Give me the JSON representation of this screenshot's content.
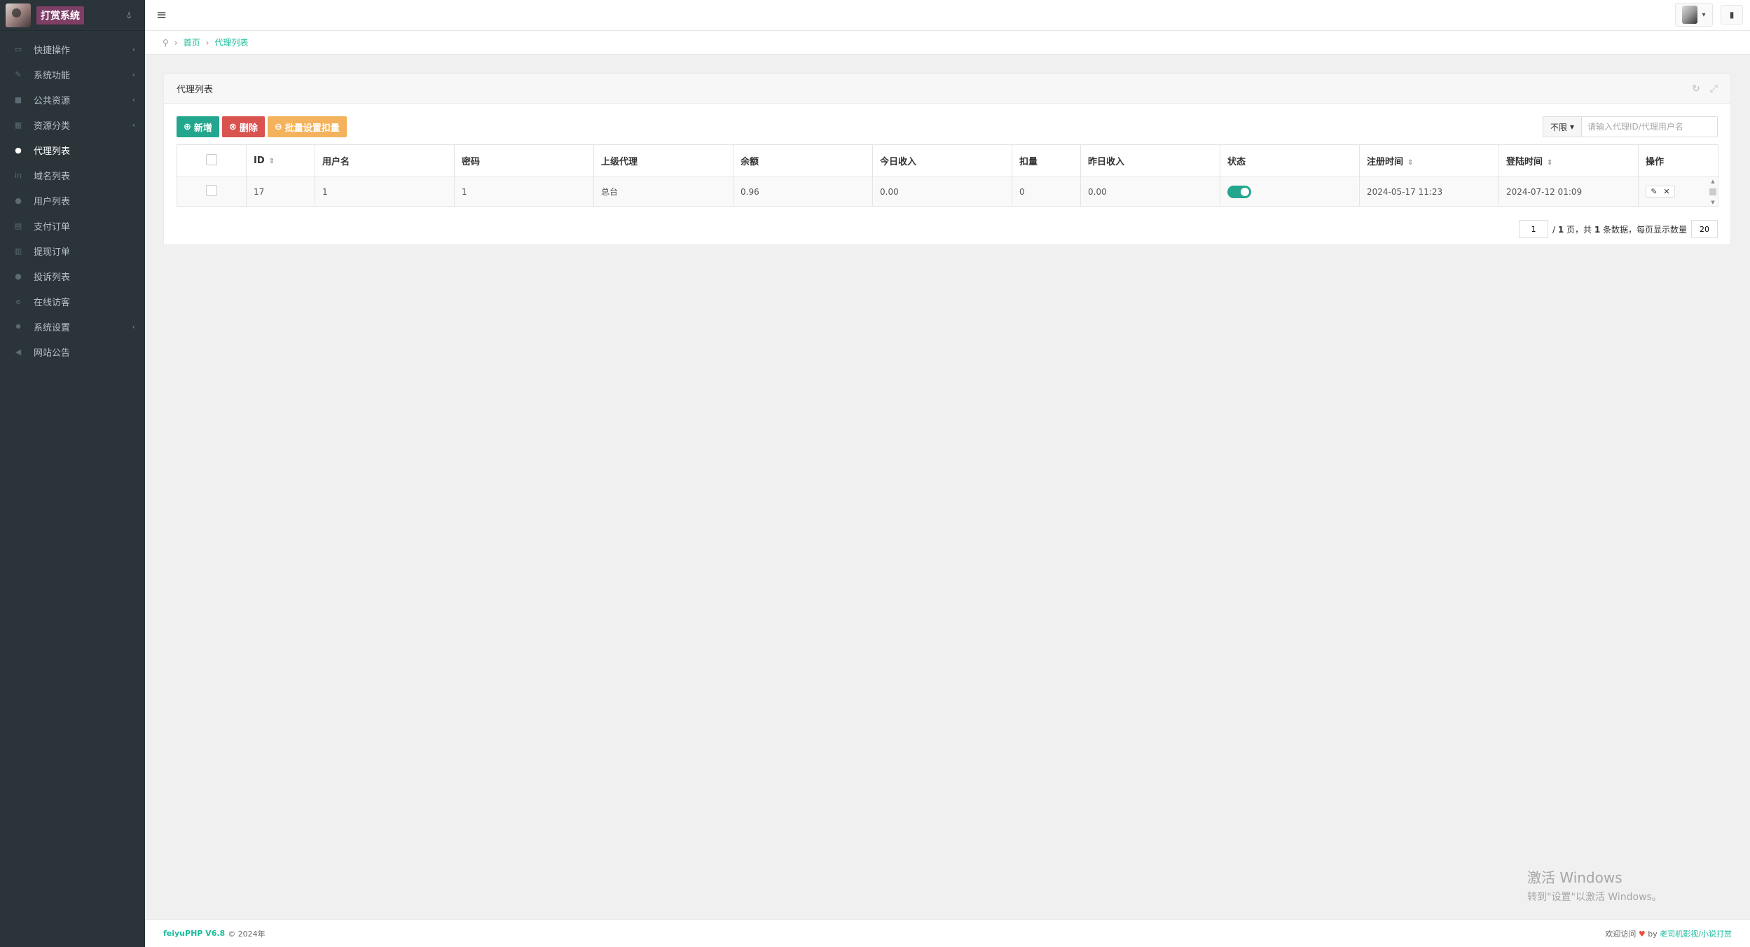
{
  "brand": {
    "name": "打赏系统",
    "drop_icon": "tint-icon"
  },
  "sidebar": {
    "items": [
      {
        "label": "快捷操作",
        "icon": "folder-open-icon",
        "has_arrow": true,
        "active": false
      },
      {
        "label": "系统功能",
        "icon": "wrench-icon",
        "has_arrow": true,
        "active": false
      },
      {
        "label": "公共资源",
        "icon": "video-camera-icon",
        "has_arrow": true,
        "active": false
      },
      {
        "label": "资源分类",
        "icon": "grid-icon",
        "has_arrow": true,
        "active": false
      },
      {
        "label": "代理列表",
        "icon": "users-icon",
        "has_arrow": false,
        "active": true
      },
      {
        "label": "域名列表",
        "icon": "linkedin-icon",
        "has_arrow": false,
        "active": false
      },
      {
        "label": "用户列表",
        "icon": "user-icon",
        "has_arrow": false,
        "active": false
      },
      {
        "label": "支付订单",
        "icon": "database-icon",
        "has_arrow": false,
        "active": false
      },
      {
        "label": "提现订单",
        "icon": "bank-icon",
        "has_arrow": false,
        "active": false
      },
      {
        "label": "投诉列表",
        "icon": "info-circle-icon",
        "has_arrow": false,
        "active": false
      },
      {
        "label": "在线访客",
        "icon": "internet-explorer-icon",
        "has_arrow": false,
        "active": false
      },
      {
        "label": "系统设置",
        "icon": "gear-icon",
        "has_arrow": true,
        "active": false
      },
      {
        "label": "网站公告",
        "icon": "bullhorn-icon",
        "has_arrow": false,
        "active": false
      }
    ]
  },
  "breadcrumb": {
    "home": "首页",
    "current": "代理列表"
  },
  "panel": {
    "title": "代理列表"
  },
  "toolbar": {
    "add": "新增",
    "delete": "删除",
    "batch": "批量设置扣量"
  },
  "filter": {
    "select": "不限",
    "placeholder": "请输入代理ID/代理用户名"
  },
  "table": {
    "headers": [
      "ID",
      "用户名",
      "密码",
      "上级代理",
      "余额",
      "今日收入",
      "扣量",
      "昨日收入",
      "状态",
      "注册时间",
      "登陆时间",
      "操作"
    ],
    "rows": [
      {
        "id": "17",
        "username": "1",
        "password": "1",
        "parent": "总台",
        "balance": "0.96",
        "today": "0.00",
        "deduct": "0",
        "yesterday": "0.00",
        "status": true,
        "reg_time": "2024-05-17 11:23",
        "login_time": "2024-07-12 01:09"
      }
    ]
  },
  "pager": {
    "page": "1",
    "text_a": "/ ",
    "total_pages": "1",
    "text_b": " 页，共 ",
    "total_items": "1",
    "text_c": " 条数据，每页显示数量",
    "page_size": "20"
  },
  "footer": {
    "version": "feiyuPHP V6.8",
    "copy": "© 2024年",
    "welcome": "欢迎访问",
    "by": " by ",
    "author": "老司机影视/小说打赏"
  },
  "watermark": {
    "line1": "激活 Windows",
    "line2": "转到\"设置\"以激活 Windows。"
  },
  "colors": {
    "sidebar_bg": "#2a3439",
    "accent": "#22a78e",
    "danger": "#d9534f",
    "warning": "#f3b25b"
  }
}
